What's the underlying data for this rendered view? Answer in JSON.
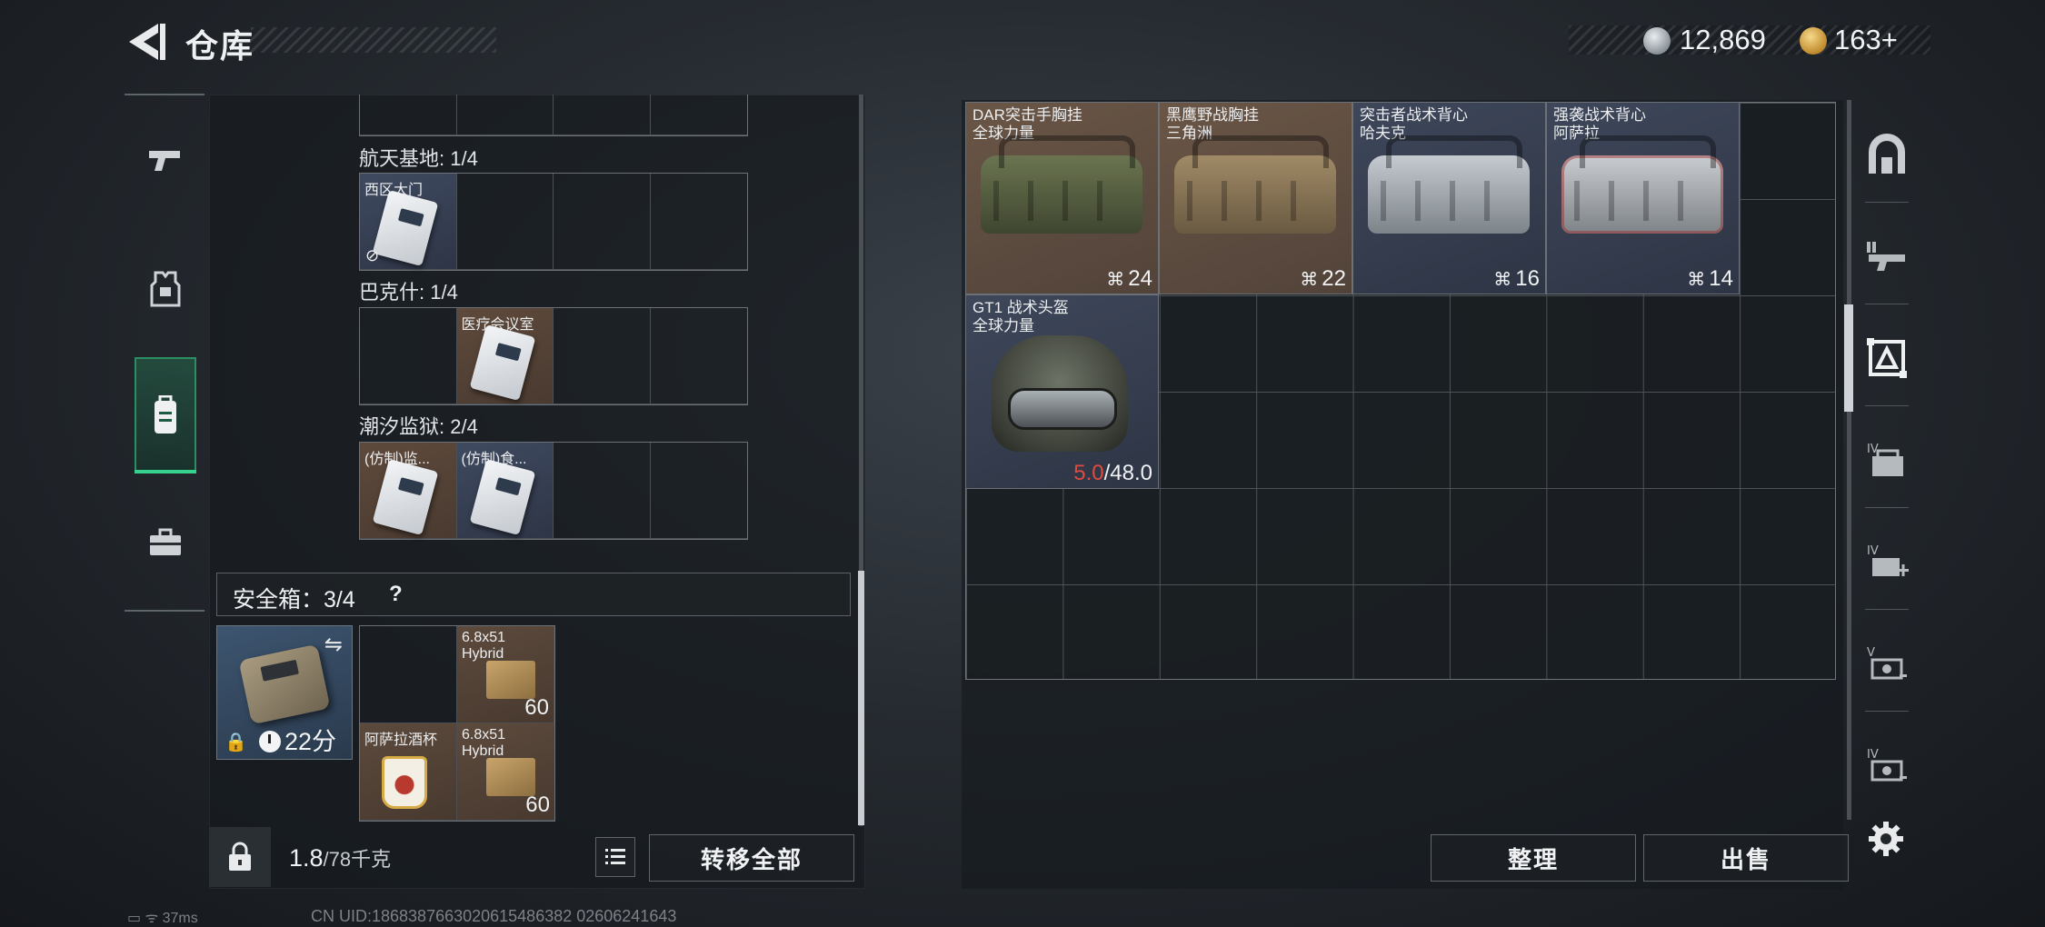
{
  "header": {
    "title": "仓库"
  },
  "currency": {
    "silver": "12,869",
    "gold": "163",
    "gold_plus": "+"
  },
  "left_nav": {
    "items": [
      "weapon",
      "armor",
      "inventory",
      "case"
    ]
  },
  "sections": [
    {
      "label": "航天基地: 1/4",
      "cells": [
        {
          "name": "西区大门",
          "type": "key",
          "broken": true
        },
        null,
        null,
        null
      ]
    },
    {
      "label": "巴克什: 1/4",
      "cells": [
        null,
        {
          "name": "医疗会议室",
          "type": "key-brown"
        },
        null,
        null
      ]
    },
    {
      "label": "潮汐监狱: 2/4",
      "cells": [
        {
          "name": "(仿制)监...",
          "type": "key-brown"
        },
        {
          "name": "(仿制)食...",
          "type": "key"
        },
        null,
        null
      ]
    }
  ],
  "safe_box": {
    "label": "安全箱：3/4",
    "help": "?",
    "timer": "22分",
    "items": [
      {
        "name": "6.8x51 Hybrid",
        "qty": "60"
      },
      {
        "name": "阿萨拉酒杯",
        "qty": ""
      },
      {
        "name": "6.8x51 Hybrid",
        "qty": "60"
      }
    ]
  },
  "footer_left": {
    "weight_current": "1.8",
    "weight_max": "/78千克",
    "transfer_all": "转移全部"
  },
  "storage": {
    "bags": [
      {
        "name": "DAR突击手胸挂",
        "sub": "全球力量",
        "capacity": "24",
        "color": "#4f5a3a"
      },
      {
        "name": "黑鹰野战胸挂",
        "sub": "三角洲",
        "capacity": "22",
        "color": "#7b6a4e"
      },
      {
        "name": "突击者战术背心",
        "sub": "哈夫克",
        "capacity": "16",
        "color": "#9ea5ad"
      },
      {
        "name": "强袭战术背心",
        "sub": "阿萨拉",
        "capacity": "14",
        "color": "#a5a9ae"
      }
    ],
    "helmet": {
      "name": "GT1 战术头盔",
      "sub": "全球力量",
      "durability_current": "5.0",
      "durability_max": "/48.0"
    }
  },
  "footer_right": {
    "sort": "整理",
    "sell": "出售"
  },
  "right_nav": {
    "items": [
      "home-icon",
      "rifle-slot-icon",
      "armor-slot-icon",
      "backpack-iv-icon",
      "medkit-iv-icon",
      "case-v-icon",
      "case-iv-icon"
    ]
  },
  "status": {
    "ping": "37ms",
    "uid": "CN UID:1868387663020615486382 02606241643"
  }
}
